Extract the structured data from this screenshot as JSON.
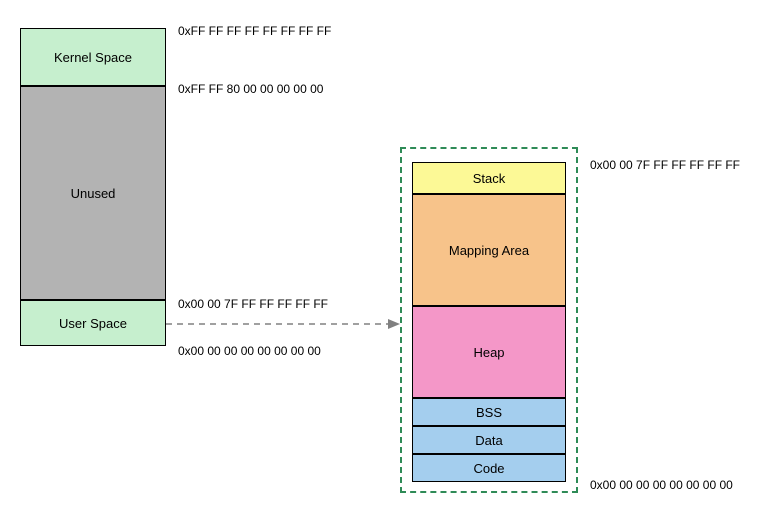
{
  "left": {
    "kernel": "Kernel Space",
    "unused": "Unused",
    "user": "User Space",
    "addr_top": "0xFF FF FF FF FF FF FF FF",
    "addr_kernel_low": "0xFF FF 80 00 00 00 00 00",
    "addr_user_high": "0x00 00 7F FF FF FF FF FF",
    "addr_bottom": "0x00 00 00 00 00 00 00 00"
  },
  "right": {
    "stack": "Stack",
    "mapping": "Mapping Area",
    "heap": "Heap",
    "bss": "BSS",
    "data": "Data",
    "code": "Code",
    "addr_top": "0x00 00 7F FF FF FF FF FF",
    "addr_bottom": "0x00 00 00 00 00 00 00 00"
  }
}
